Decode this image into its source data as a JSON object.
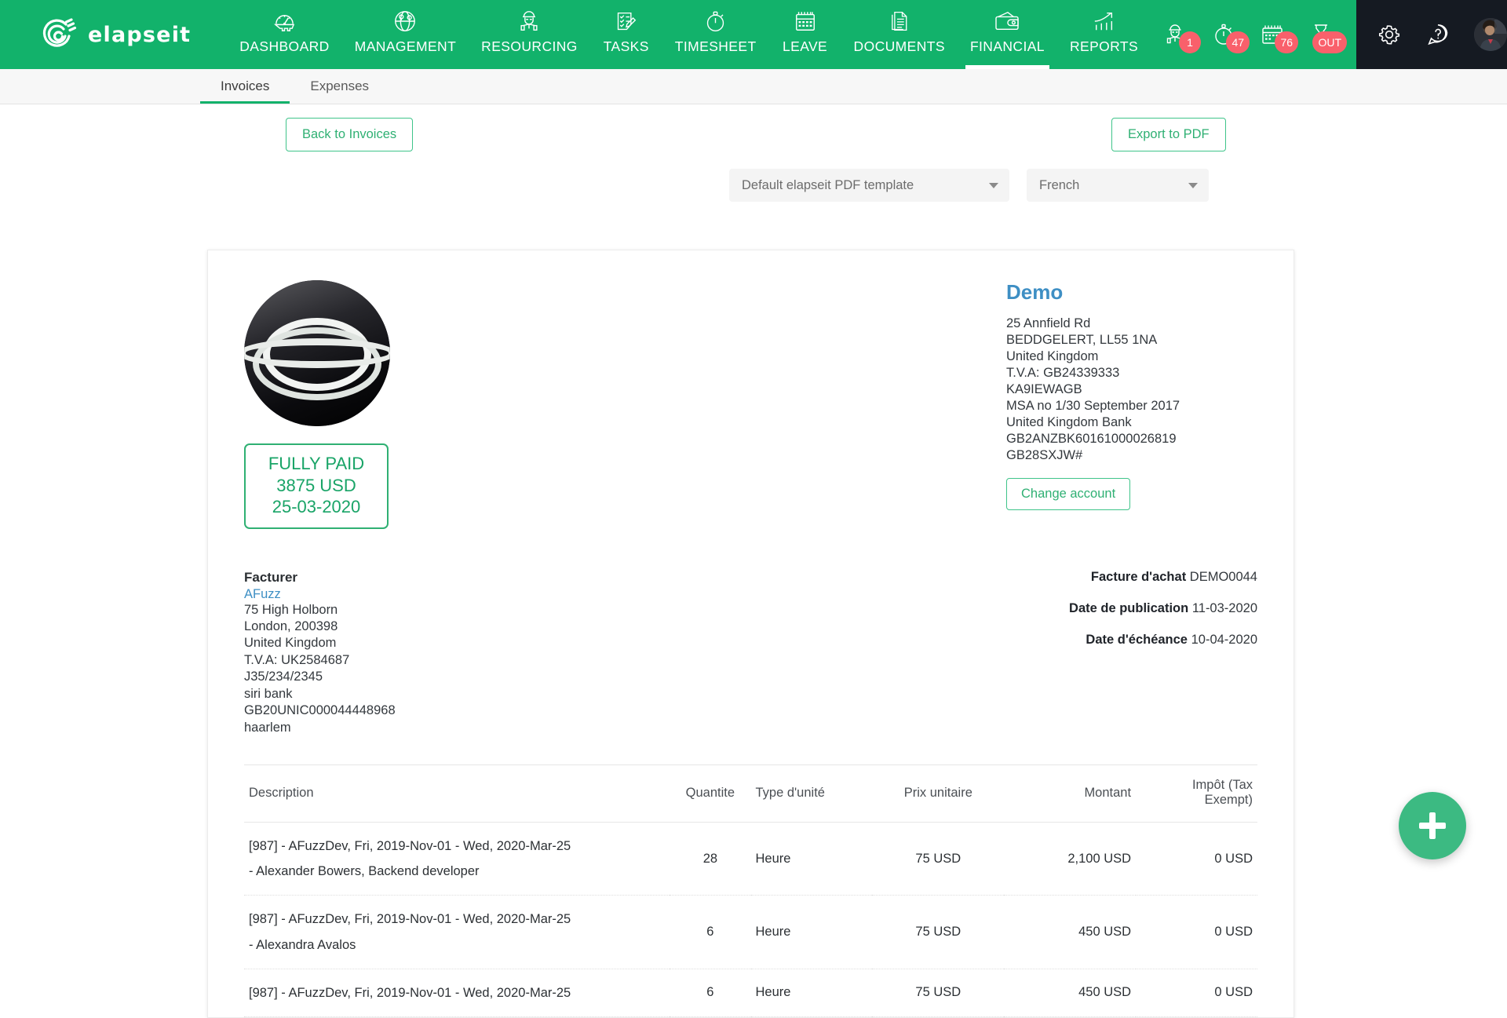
{
  "app": {
    "brand_name": "elapseit"
  },
  "nav": {
    "items": [
      {
        "label": "DASHBOARD",
        "icon": "dashboard-gauge-icon",
        "active": false
      },
      {
        "label": "MANAGEMENT",
        "icon": "globe-icon",
        "active": false
      },
      {
        "label": "RESOURCING",
        "icon": "worker-icon",
        "active": false
      },
      {
        "label": "TASKS",
        "icon": "checklist-pencil-icon",
        "active": false
      },
      {
        "label": "TIMESHEET",
        "icon": "stopwatch-icon",
        "active": false
      },
      {
        "label": "LEAVE",
        "icon": "calendar-icon",
        "active": false
      },
      {
        "label": "DOCUMENTS",
        "icon": "documents-icon",
        "active": false
      },
      {
        "label": "FINANCIAL",
        "icon": "wallet-icon",
        "active": true
      },
      {
        "label": "REPORTS",
        "icon": "bar-chart-arrow-icon",
        "active": false
      }
    ],
    "notifications": [
      {
        "icon": "worker-alert-icon",
        "badge": "1"
      },
      {
        "icon": "stopwatch-alert-icon",
        "badge": "47"
      },
      {
        "icon": "calendar-alert-icon",
        "badge": "76"
      },
      {
        "icon": "hourglass-icon",
        "badge": "OUT"
      }
    ],
    "right_icons": [
      {
        "icon": "gear-icon"
      },
      {
        "icon": "help-question-icon"
      },
      {
        "icon": "user-avatar"
      }
    ],
    "colors": {
      "nav_green": "#12b26b",
      "dark_panel": "#151a22",
      "badge_red": "#f9606b"
    }
  },
  "subtabs": [
    {
      "label": "Invoices",
      "active": true
    },
    {
      "label": "Expenses",
      "active": false
    }
  ],
  "toolbar": {
    "back_label": "Back to Invoices",
    "export_label": "Export to PDF"
  },
  "selects": {
    "template": {
      "value": "Default elapseit PDF template",
      "icon": "chevron-down-icon"
    },
    "language": {
      "value": "French",
      "icon": "chevron-down-icon"
    }
  },
  "invoice": {
    "logo_alt": "company-logo",
    "status_badge": {
      "status": "FULLY PAID",
      "amount": "3875 USD",
      "date": "25-03-2020",
      "color": "#19a467"
    },
    "issuer": {
      "name": "Demo",
      "lines": [
        "25 Annfield Rd",
        "BEDDGELERT, LL55 1NA",
        "United Kingdom",
        "T.V.A: GB24339333",
        "KA9IEWAGB",
        "MSA no 1/30 September 2017",
        "United Kingdom Bank",
        "GB2ANZBK60161000026819",
        "GB28SXJW#"
      ],
      "change_account_label": "Change account",
      "name_color": "#3e8fc4"
    },
    "bill_to": {
      "title": "Facturer",
      "link": "AFuzz",
      "lines": [
        "75 High Holborn",
        "London, 200398",
        "United Kingdom",
        "T.V.A: UK2584687",
        "J35/234/2345",
        "siri bank",
        "GB20UNIC000044448968",
        "haarlem"
      ]
    },
    "meta": [
      {
        "label": "Facture d'achat",
        "value": "DEMO0044"
      },
      {
        "label": "Date de publication",
        "value": "11-03-2020"
      },
      {
        "label": "Date d'échéance",
        "value": "10-04-2020"
      }
    ],
    "table": {
      "headers": {
        "description": "Description",
        "quantity": "Quantite",
        "unit_type": "Type d'unité",
        "unit_price": "Prix unitaire",
        "amount": "Montant",
        "tax": "Impôt (Tax Exempt)"
      },
      "rows": [
        {
          "description_line1": "[987] - AFuzzDev, Fri, 2019-Nov-01 - Wed, 2020-Mar-25",
          "description_line2": "- Alexander Bowers, Backend developer",
          "quantity": "28",
          "unit_type": "Heure",
          "unit_price": "75 USD",
          "amount": "2,100 USD",
          "tax": "0 USD"
        },
        {
          "description_line1": "[987] - AFuzzDev, Fri, 2019-Nov-01 - Wed, 2020-Mar-25",
          "description_line2": "- Alexandra Avalos",
          "quantity": "6",
          "unit_type": "Heure",
          "unit_price": "75 USD",
          "amount": "450 USD",
          "tax": "0 USD"
        },
        {
          "description_line1": "[987] - AFuzzDev, Fri, 2019-Nov-01 - Wed, 2020-Mar-25",
          "description_line2": "",
          "quantity": "6",
          "unit_type": "Heure",
          "unit_price": "75 USD",
          "amount": "450 USD",
          "tax": "0 USD"
        }
      ]
    }
  },
  "fab": {
    "icon": "plus-icon",
    "color": "#3cba82"
  }
}
